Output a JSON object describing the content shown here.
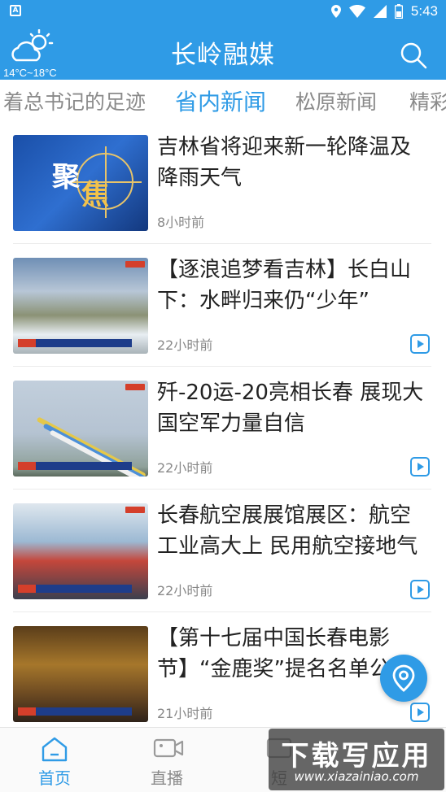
{
  "status_bar": {
    "time": "5:43",
    "left_icon": "A",
    "icons": [
      "location-icon",
      "wifi-icon",
      "signal-icon",
      "battery-icon"
    ]
  },
  "header": {
    "title": "长岭融媒",
    "weather_temp": "14°C~18°C",
    "weather_icon": "partly-cloudy-icon",
    "search_icon": "search-icon"
  },
  "tabs": [
    {
      "label": "着总书记的足迹",
      "active": false
    },
    {
      "label": "省内新闻",
      "active": true
    },
    {
      "label": "松原新闻",
      "active": false
    },
    {
      "label": "精彩",
      "active": false
    }
  ],
  "news": [
    {
      "title": "吉林省将迎来新一轮降温及降雨天气",
      "time": "8小时前",
      "video": false,
      "thumb_text": [
        "聚",
        "焦"
      ]
    },
    {
      "title": "【逐浪追梦看吉林】长白山下：水畔归来仍“少年”",
      "time": "22小时前",
      "video": true
    },
    {
      "title": "歼-20运-20亮相长春 展现大国空军力量自信",
      "time": "22小时前",
      "video": true
    },
    {
      "title": "长春航空展展馆展区：航空工业高大上 民用航空接地气",
      "time": "22小时前",
      "video": true
    },
    {
      "title": "【第十七届中国长春电影节】“金鹿奖”提名名单公布",
      "time": "21小时前",
      "video": true
    }
  ],
  "fab": {
    "icon": "location-pin-icon"
  },
  "bottom_nav": [
    {
      "label": "首页",
      "icon": "home-icon",
      "active": true
    },
    {
      "label": "直播",
      "icon": "video-camera-icon",
      "active": false
    },
    {
      "label": "短",
      "icon": "short-video-icon",
      "active": false
    }
  ],
  "watermark": {
    "main": "下载写应用",
    "sub": "www.xiazainiao.com"
  },
  "colors": {
    "primary": "#2f9be6",
    "text": "#222222",
    "muted": "#888888"
  }
}
